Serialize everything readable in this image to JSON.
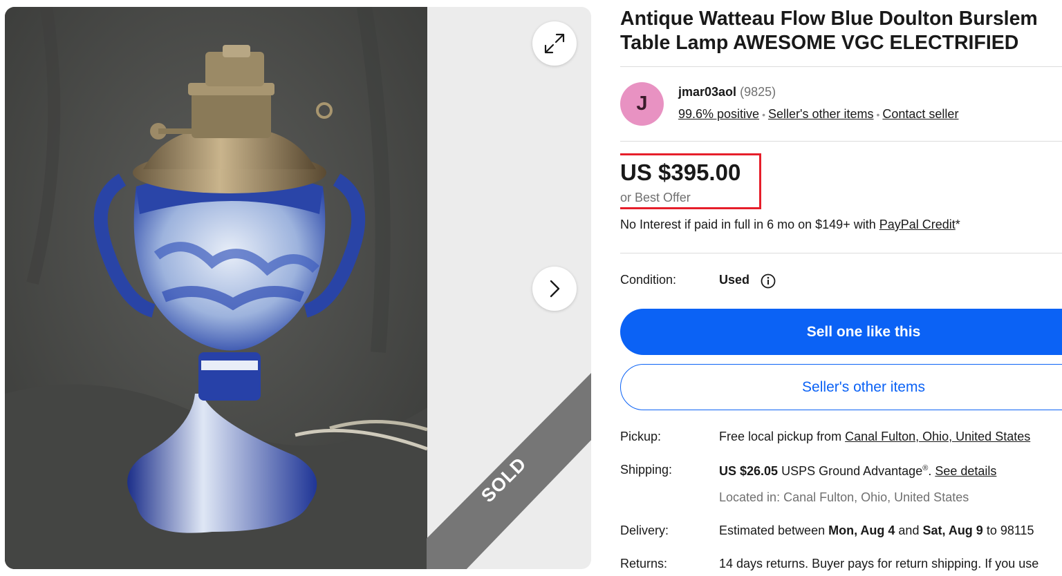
{
  "gallery": {
    "sold_label": "SOLD",
    "expand_icon": "expand-arrows-icon",
    "next_icon": "chevron-right-icon"
  },
  "listing": {
    "title_line1": "Antique Watteau Flow Blue Doulton Burslem",
    "title_line2": "Table Lamp AWESOME VGC ELECTRIFIED"
  },
  "seller": {
    "avatar_initial": "J",
    "name": "jmar03aol",
    "feedback_count": "(9825)",
    "positive": "99.6% positive",
    "other_items_link": "Seller's other items",
    "contact_link": "Contact seller"
  },
  "price": {
    "amount": "US $395.00",
    "best_offer": "or Best Offer",
    "financing_prefix": "No Interest if paid in full in 6 mo on $149+ with ",
    "financing_link": "PayPal Credit",
    "financing_suffix": "*"
  },
  "condition": {
    "label": "Condition:",
    "value": "Used"
  },
  "buttons": {
    "sell_one": "Sell one like this",
    "sellers_other_items": "Seller's other items"
  },
  "pickup": {
    "label": "Pickup:",
    "prefix": "Free local pickup from ",
    "location_link": "Canal Fulton, Ohio, United States"
  },
  "shipping": {
    "label": "Shipping:",
    "cost": "US $26.05",
    "service": " USPS Ground Advantage",
    "reg": "®",
    "period": ". ",
    "details_link": "See details",
    "located": "Located in: Canal Fulton, Ohio, United States"
  },
  "delivery": {
    "label": "Delivery:",
    "prefix": "Estimated between ",
    "start": "Mon, Aug 4",
    "and": " and ",
    "end": "Sat, Aug 9",
    "suffix": " to 98115"
  },
  "returns": {
    "label": "Returns:",
    "text": "14 days returns. Buyer pays for return shipping. If you use"
  },
  "colors": {
    "accent_blue": "#0b62f5",
    "highlight_red": "#e61e2a",
    "avatar_pink": "#e892c2",
    "sold_ribbon": "#767676"
  }
}
